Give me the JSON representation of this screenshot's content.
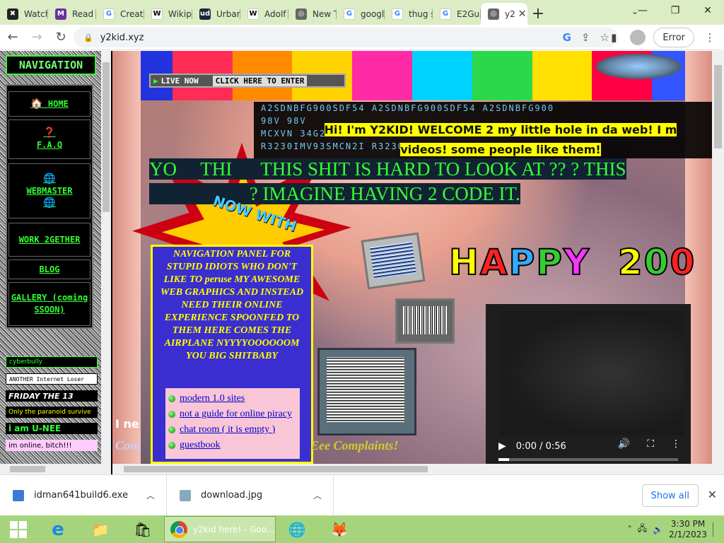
{
  "browser": {
    "tabs": [
      {
        "label": "Watch",
        "fav_color": "#222"
      },
      {
        "label": "Read",
        "fav_color": "#6b2fa0"
      },
      {
        "label": "Create",
        "fav_color": "#4285f4"
      },
      {
        "label": "Wikip",
        "fav_color": "#555"
      },
      {
        "label": "Urban",
        "fav_color": "#1d2439"
      },
      {
        "label": "Adolf",
        "fav_color": "#555"
      },
      {
        "label": "New T",
        "fav_color": "#666"
      },
      {
        "label": "googl",
        "fav_color": "#4285f4"
      },
      {
        "label": "thug s",
        "fav_color": "#4285f4"
      },
      {
        "label": "E2Gu",
        "fav_color": "#4285f4"
      },
      {
        "label": "y2",
        "fav_color": "#666"
      }
    ],
    "new_tab": "+",
    "url": "y2kid.xyz",
    "error_button": "Error"
  },
  "sidebar": {
    "title": "NAVIGATION",
    "items": [
      {
        "label": "HOME"
      },
      {
        "label": "F.A.Q"
      },
      {
        "label": "WEBMASTER"
      },
      {
        "label": "WORK 2GETHER"
      },
      {
        "label": "BLOG"
      },
      {
        "label": "GALLERY (coming SSOON)"
      }
    ],
    "badges": [
      "cyberbully",
      "ANOTHER Internet Loser",
      "FRIDAY THE 13",
      "Only the paranoid survive",
      "i am U-NEE",
      "im online, bitch!!!"
    ]
  },
  "main": {
    "live_label": "LIVE NOW",
    "enter_label": "CLICK HERE TO ENTER",
    "matrix_lines": [
      "A2SDNBFG900SDF54  A2SDNBFG900SDF54  A2SDNBFG900",
      "98V                                  98V",
      "MCXVN                                 34G2CM",
      "R3230IMV93SMCN2I               R3230IMV93S"
    ],
    "welcome_line1": "Hi! I'm Y2KID! WELCOME 2 my little hole in da web! I m",
    "welcome_line2": "videos! some people like them!",
    "big_line1": "YO     THI      THIS SHIT IS HARD TO LOOK AT ?? ? THIS",
    "big_line2": "                     ? IMAGINE HAVING 2 CODE IT.",
    "now_with": "NOW WITH",
    "nav_panel_text": "NAVIGATION PANEL FOR STUPID IDIOTS WHO DON'T LIKE TO peruse MY AWESOME WEB GRAPHICS AND INSTEAD NEED THEIR ONLINE EXPERIENCE SPOONFED TO THEM HERE COMES THE AIRPLANE NYYYYOOOOOOM YOU BIG SHITBABY",
    "nav_links": [
      {
        "label": "modern 1.0 sites"
      },
      {
        "label": "not a guide for online piracy"
      },
      {
        "label": "chat room ( it is empty )"
      },
      {
        "label": "guestbook"
      }
    ],
    "happy": {
      "h": "H",
      "a": "A",
      "p1": "P",
      "p2": "P",
      "y": "Y",
      "n": "2",
      "z": "0",
      "z2": "0"
    },
    "video": {
      "time": "0:00 / 0:56",
      "progress": 0.06
    },
    "complaints": "Eee Complaints!",
    "ineed": "I ne",
    "com": "Com"
  },
  "downloads": {
    "items": [
      {
        "name": "idman641build6.exe"
      },
      {
        "name": "download.jpg"
      }
    ],
    "show_all": "Show all"
  },
  "taskbar": {
    "chrome_label": "y2kid here! - Goo...",
    "time": "3:30 PM",
    "date": "2/1/2023"
  }
}
